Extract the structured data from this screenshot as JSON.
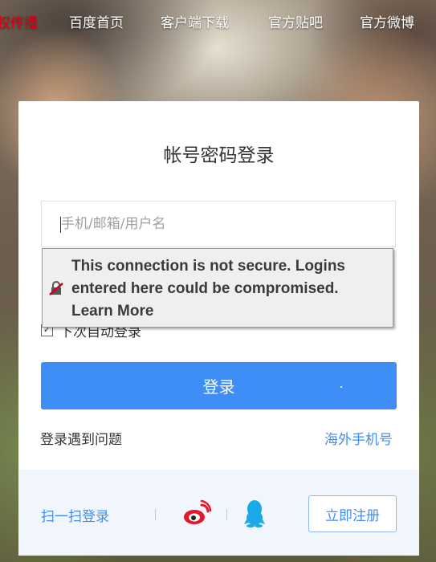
{
  "topnav": {
    "items": [
      "权传播",
      "百度首页",
      "客户端下载",
      "官方贴吧",
      "官方微博"
    ]
  },
  "login": {
    "title": "帐号密码登录",
    "username_placeholder": "手机/邮箱/用户名",
    "remember_label": "下次自动登录",
    "submit_label": "登录",
    "help_link": "登录遇到问题",
    "overseas_link": "海外手机号"
  },
  "footer": {
    "qr_login": "扫一扫登录",
    "register": "立即注册"
  },
  "warning": {
    "message": "This connection is not secure. Logins entered here could be compromised.",
    "learn_more": "Learn More"
  },
  "colors": {
    "accent": "#3f8ef7",
    "active_nav": "#e60012",
    "weibo": "#e6162d",
    "qq": "#1aaae8"
  },
  "icons": {
    "weibo": "weibo-icon",
    "qq": "qq-icon",
    "warning": "insecure-lock-icon"
  }
}
